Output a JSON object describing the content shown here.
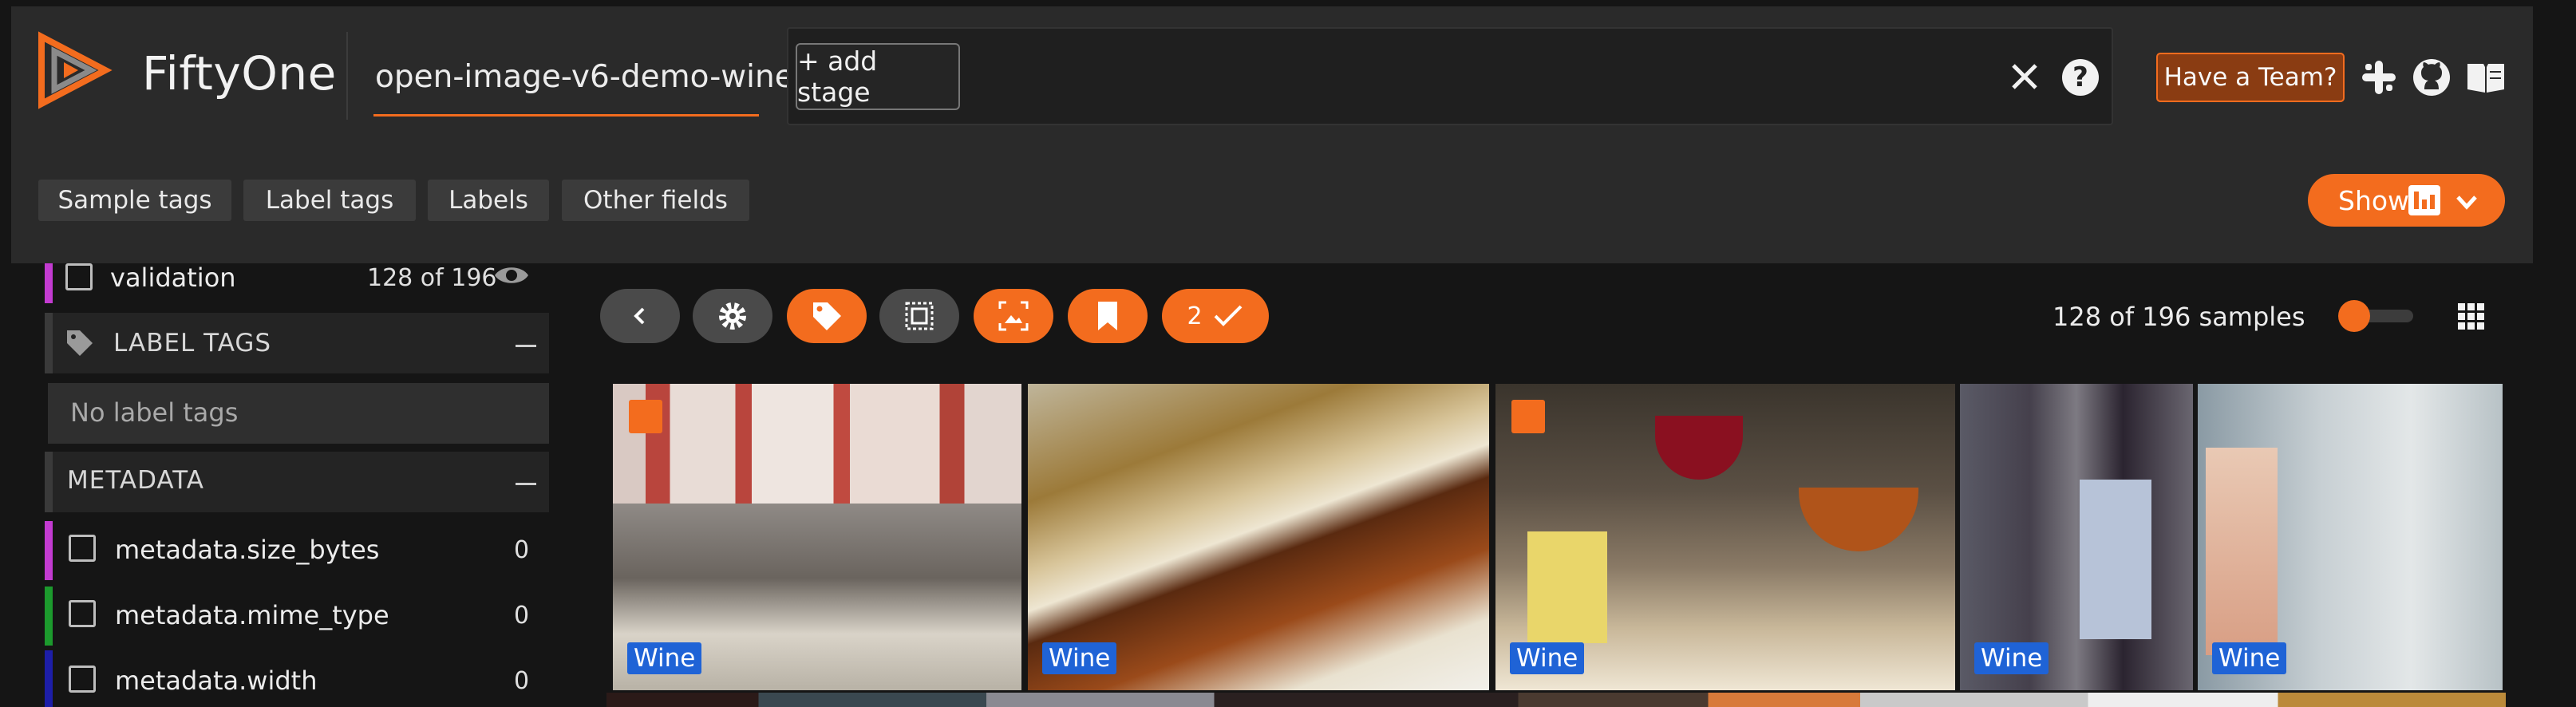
{
  "header": {
    "brand": "FiftyOne",
    "dataset_name": "open-image-v6-demo-wine",
    "add_stage_label": "+ add stage",
    "team_label": "Have a Team?"
  },
  "filter_tabs": [
    "Sample tags",
    "Label tags",
    "Labels",
    "Other fields"
  ],
  "show_button_label": "Show",
  "sidebar": {
    "validation": {
      "label": "validation",
      "count": "128 of 196"
    },
    "label_tags": {
      "title": "LABEL TAGS",
      "empty": "No label tags"
    },
    "metadata": {
      "title": "METADATA"
    },
    "fields": [
      {
        "label": "metadata.size_bytes",
        "value": "0",
        "color": "#c33bd1"
      },
      {
        "label": "metadata.mime_type",
        "value": "0",
        "color": "#1c9a2d"
      },
      {
        "label": "metadata.width",
        "value": "0",
        "color": "#1d1ea8"
      }
    ],
    "validation_color": "#c33bd1"
  },
  "toolbar": {
    "selected_count": "2",
    "samples_count": "128 of 196 samples"
  },
  "tiles": [
    {
      "label": "Wine",
      "checked": true
    },
    {
      "label": "Wine",
      "checked": false
    },
    {
      "label": "Wine",
      "checked": true
    },
    {
      "label": "Wine",
      "checked": false
    },
    {
      "label": "Wine",
      "checked": false
    }
  ],
  "colors": {
    "accent": "#f36c1e",
    "label_badge": "#1f63d6"
  }
}
